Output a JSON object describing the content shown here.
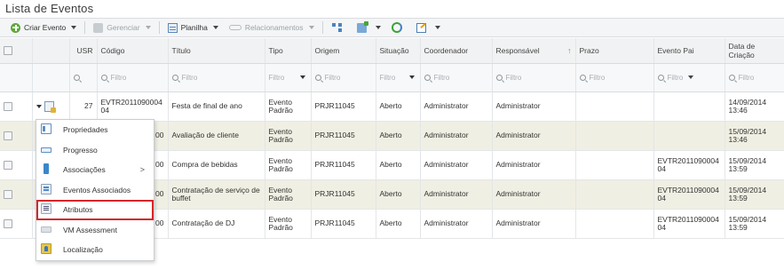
{
  "page": {
    "title": "Lista de Eventos"
  },
  "toolbar": {
    "create_event": "Criar Evento",
    "manage": "Gerenciar",
    "spreadsheet": "Planilha",
    "relationships": "Relacionamentos"
  },
  "columns": {
    "usr": "USR",
    "code": "Código",
    "title": "Título",
    "type": "Tipo",
    "origin": "Origem",
    "status": "Situação",
    "coordinator": "Coordenador",
    "responsible": "Responsável",
    "deadline": "Prazo",
    "parent_event": "Evento Pai",
    "created_date": "Data de Criação"
  },
  "filters": {
    "placeholder": "Filtro"
  },
  "rows": [
    {
      "usr": "27",
      "code": "EVTR201109000404",
      "title": "Festa de final de ano",
      "type": "Evento Padrão",
      "origin": "PRJR11045",
      "status": "Aberto",
      "coordinator": "Administrator",
      "responsible": "Administrator",
      "deadline": "",
      "parent": "",
      "created": "14/09/2014 13:46"
    },
    {
      "usr": "",
      "code": "00",
      "title": "Avaliação de cliente",
      "type": "Evento Padrão",
      "origin": "PRJR11045",
      "status": "Aberto",
      "coordinator": "Administrator",
      "responsible": "Administrator",
      "deadline": "",
      "parent": "",
      "created": "15/09/2014 13:46"
    },
    {
      "usr": "",
      "code": "00",
      "title": "Compra de bebidas",
      "type": "Evento Padrão",
      "origin": "PRJR11045",
      "status": "Aberto",
      "coordinator": "Administrator",
      "responsible": "Administrator",
      "deadline": "",
      "parent": "EVTR201109000404",
      "created": "15/09/2014 13:59"
    },
    {
      "usr": "",
      "code": "00",
      "title": "Contratação de serviço de buffet",
      "type": "Evento Padrão",
      "origin": "PRJR11045",
      "status": "Aberto",
      "coordinator": "Administrator",
      "responsible": "Administrator",
      "deadline": "",
      "parent": "EVTR201109000404",
      "created": "15/09/2014 13:59"
    },
    {
      "usr": "",
      "code": "00",
      "title": "Contratação de DJ",
      "type": "Evento Padrão",
      "origin": "PRJR11045",
      "status": "Aberto",
      "coordinator": "Administrator",
      "responsible": "Administrator",
      "deadline": "",
      "parent": "EVTR201109000404",
      "created": "15/09/2014 13:59"
    }
  ],
  "context_menu": {
    "items": [
      {
        "label": "Propriedades",
        "icon": "properties-icon"
      },
      {
        "label": "Progresso",
        "icon": "progress-icon"
      },
      {
        "label": "Associações",
        "icon": "associations-icon",
        "submenu_arrow": ">"
      },
      {
        "label": "Eventos Associados",
        "icon": "associated-events-icon"
      },
      {
        "label": "Atributos",
        "icon": "attributes-icon"
      },
      {
        "label": "VM Assessment",
        "icon": "vm-assessment-icon"
      },
      {
        "label": "Localização",
        "icon": "location-icon"
      }
    ]
  },
  "colors": {
    "highlight_outline": "#d4262b",
    "alt_row": "#f0efe3"
  }
}
